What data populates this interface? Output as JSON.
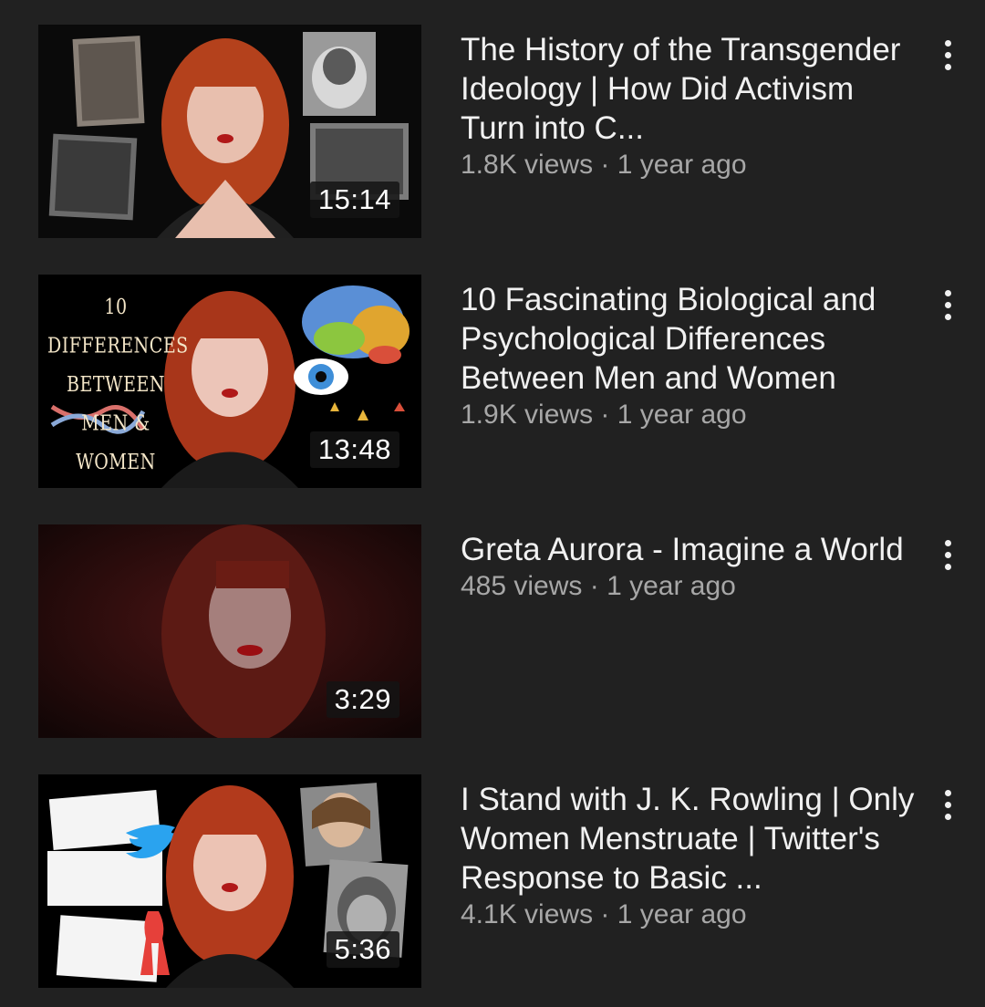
{
  "videos": [
    {
      "title": "The History of the Transgender Ideology | How Did Activism Turn into C...",
      "views": "1.8K views",
      "age": "1 year ago",
      "duration": "15:14",
      "thumbnail_overlay": ""
    },
    {
      "title": "10 Fascinating Biological and Psychological Differences Between Men and Women",
      "views": "1.9K views",
      "age": "1 year ago",
      "duration": "13:48",
      "thumbnail_overlay": "10 DIFFERENCES BETWEEN MEN & WOMEN"
    },
    {
      "title": "Greta Aurora - Imagine a World",
      "views": "485 views",
      "age": "1 year ago",
      "duration": "3:29",
      "thumbnail_overlay": ""
    },
    {
      "title": "I Stand with J. K. Rowling | Only Women Menstruate | Twitter's Response to Basic ...",
      "views": "4.1K views",
      "age": "1 year ago",
      "duration": "5:36",
      "thumbnail_overlay": ""
    }
  ],
  "separator": " · ",
  "icons": {
    "menu": "more-vertical-icon"
  },
  "colors": {
    "background": "#212121",
    "title": "#f1f1f1",
    "secondary": "#a7a7a7"
  }
}
